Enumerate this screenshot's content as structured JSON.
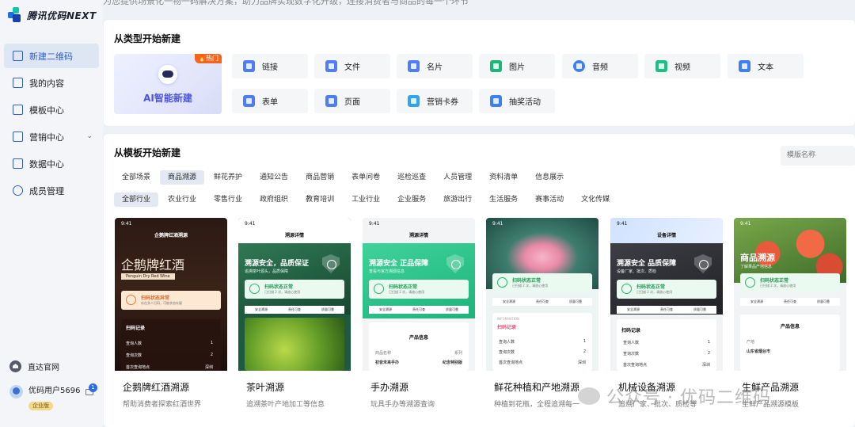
{
  "app": {
    "logo_text": "腾讯优码NEXT",
    "notice": "为您提供场景化一物一码解决方案，助力品牌实现数字化升级，连接消费者与商品的每一个环节"
  },
  "sidebar": {
    "items": [
      {
        "label": "新建二维码",
        "icon": "qrcode-grid-icon"
      },
      {
        "label": "我的内容",
        "icon": "document-icon"
      },
      {
        "label": "模板中心",
        "icon": "template-icon"
      },
      {
        "label": "营销中心",
        "icon": "chart-icon"
      },
      {
        "label": "数据中心",
        "icon": "data-icon"
      },
      {
        "label": "成员管理",
        "icon": "member-icon"
      }
    ],
    "marketing_chevron": "⌄",
    "official_site": "直达官网",
    "user_name": "优码用户5696",
    "user_badge": "企业版",
    "message_count": "1"
  },
  "type_section": {
    "title": "从类型开始新建",
    "ai_card": {
      "label": "AI智能新建",
      "badge": "🔥热门"
    },
    "types": [
      {
        "label": "链接",
        "color": "#4f7df5",
        "icon": "link-icon"
      },
      {
        "label": "文件",
        "color": "#4f7df5",
        "icon": "file-icon"
      },
      {
        "label": "名片",
        "color": "#4f7df5",
        "icon": "card-icon"
      },
      {
        "label": "图片",
        "color": "#1cb57a",
        "icon": "image-icon"
      },
      {
        "label": "音频",
        "color": "#3d7ff5",
        "icon": "audio-icon"
      },
      {
        "label": "视频",
        "color": "#1ebf85",
        "icon": "video-icon"
      },
      {
        "label": "文本",
        "color": "#3d7ff5",
        "icon": "text-icon"
      },
      {
        "label": "表单",
        "color": "#4f7df5",
        "icon": "form-icon"
      },
      {
        "label": "页面",
        "color": "#4f7df5",
        "icon": "page-icon"
      },
      {
        "label": "营销卡券",
        "color": "#2fa4f2",
        "icon": "coupon-icon"
      },
      {
        "label": "抽奖活动",
        "color": "#3d7ff5",
        "icon": "gift-icon"
      }
    ]
  },
  "template_section": {
    "title": "从模板开始新建",
    "search_placeholder": "模版名称",
    "scene_tabs": [
      "全部场景",
      "商品溯源",
      "鲜花养护",
      "通知公告",
      "商品营销",
      "表单问卷",
      "巡检巡查",
      "人员管理",
      "资料清单",
      "信息展示"
    ],
    "scene_active": 1,
    "industry_tabs": [
      "全部行业",
      "农业行业",
      "零售行业",
      "政府组织",
      "教育培训",
      "工业行业",
      "企业服务",
      "旅游出行",
      "生活服务",
      "赛事活动",
      "文化传媒"
    ],
    "industry_active": 0,
    "templates": [
      {
        "title": "企鹅牌红酒溯源",
        "desc": "帮助消费者探索红酒世界",
        "phone_time": "9:41",
        "nav_title": "企鹅牌红酒溯源",
        "hero": "企鹅牌红酒",
        "hero_en": "Penguin Dry Red Wine",
        "status": "扫码状态异常",
        "status_sub": "存在多人扫码，可能状态存疑",
        "section": "扫码记录",
        "rows": [
          [
            "查询人数",
            "1"
          ],
          [
            "查询次数",
            "2"
          ],
          [
            "首次查询地点",
            "深圳"
          ]
        ]
      },
      {
        "title": "茶叶溯源",
        "desc": "追溯茶叶产地加工等信息",
        "phone_time": "9:41",
        "nav_title": "溯源详情",
        "hero": "溯源安全，品质保证",
        "hero_sub": "追溯茶叶源头，品质保障",
        "status": "扫码状态正常",
        "status_sub": "已扫描 2 次，请放心使用",
        "checks": [
          "安全溯源",
          "责任可查",
          "质量可靠"
        ]
      },
      {
        "title": "手办溯源",
        "desc": "玩具手办等溯源查询",
        "phone_time": "9:41",
        "nav_title": "溯源详情",
        "hero": "溯源安全 正品保障",
        "hero_sub": "查看与官方溯源信息",
        "status": "扫码状态正常",
        "status_sub": "已扫描 2 次，请放心使用",
        "checks": [
          "安全溯源",
          "责任可查",
          "质量可靠"
        ],
        "section": "产品信息",
        "rows": [
          [
            "商品名称",
            "系列"
          ],
          [
            "初音未来手办",
            "纪念特别版"
          ]
        ]
      },
      {
        "title": "鲜花种植和产地溯源",
        "desc": "种植到花瓶，全程追溯每一",
        "phone_time": "9:41",
        "status": "扫码状态正常",
        "status_sub": "已扫描 2 次，请放心使用",
        "checks": [
          "安全溯源",
          "责任可查",
          "质量可靠"
        ],
        "section_en": "INFORMATION",
        "section": "扫码记录",
        "rows": [
          [
            "查询人数",
            "1"
          ],
          [
            "查询次数",
            "2"
          ],
          [
            "首次查询地点",
            "深圳"
          ]
        ]
      },
      {
        "title": "机械设备溯源",
        "desc": "追溯厂家、批次、质检等",
        "phone_time": "9:41",
        "nav_title": "设备详情",
        "hero": "溯源安全 品质保障",
        "hero_sub": "设备厂家、批次、质检",
        "status": "扫码状态正常",
        "status_sub": "已扫描 2 次，请放心使用",
        "checks": [
          "安全溯源",
          "责任可查",
          "质量可靠"
        ],
        "section": "扫码记录",
        "rows": [
          [
            "查询人数",
            "1"
          ],
          [
            "查询次数",
            "2"
          ],
          [
            "首次查询地点",
            "深圳"
          ]
        ]
      },
      {
        "title": "生鲜产品溯源",
        "desc": "生鲜产品溯源模板",
        "phone_time": "9:41",
        "hero": "商品溯源",
        "hero_sub": "了解果品产地信息",
        "status": "扫码状态正常",
        "status_sub": "已扫描 2 次，请放心使用",
        "checks": [
          "安全溯源",
          "责任可查",
          "质量可靠"
        ],
        "section": "产品信息",
        "rows": [
          [
            "产地",
            ""
          ],
          [
            "山东省烟台市",
            ""
          ]
        ]
      }
    ]
  },
  "watermark": "公众号 · 优码二维码",
  "colors": {
    "accent": "#2d5ec9",
    "green": "#25b864",
    "wine_bg": "#2a1612",
    "hot": "#f4641f"
  }
}
